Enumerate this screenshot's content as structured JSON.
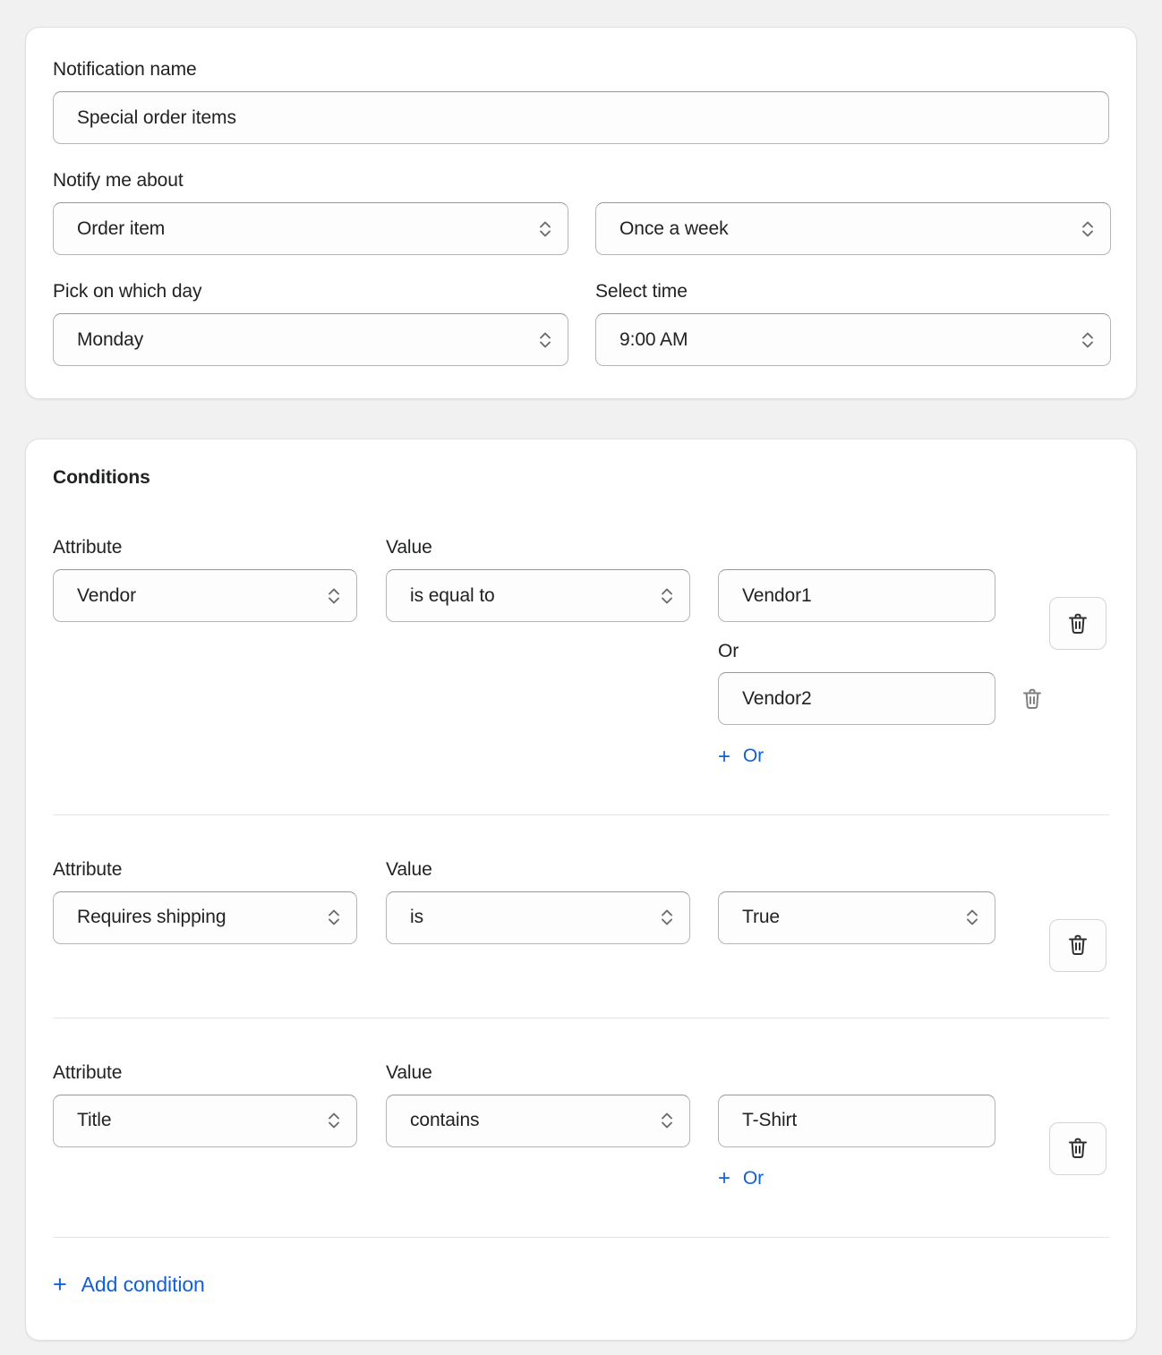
{
  "notification": {
    "name_label": "Notification name",
    "name_value": "Special order items",
    "name_placeholder": "Notification name",
    "notify_about_label": "Notify me about",
    "notify_about_value": "Order item",
    "frequency_value": "Once a week",
    "day_label": "Pick on which day",
    "day_value": "Monday",
    "time_label": "Select time",
    "time_value": "9:00 AM"
  },
  "conditions": {
    "title": "Conditions",
    "attribute_label": "Attribute",
    "value_label": "Value",
    "or_label": "Or",
    "add_or_label": "Or",
    "add_condition_label": "Add condition",
    "plus_glyph": "+",
    "rows": [
      {
        "attribute": "Vendor",
        "operator": "is equal to",
        "value": "Vendor1",
        "value_type": "input",
        "or_values": [
          {
            "value": "Vendor2",
            "value_type": "input"
          }
        ],
        "has_add_or": true
      },
      {
        "attribute": "Requires shipping",
        "operator": "is",
        "value": "True",
        "value_type": "select",
        "or_values": [],
        "has_add_or": false
      },
      {
        "attribute": "Title",
        "operator": "contains",
        "value": "T-Shirt",
        "value_type": "input",
        "or_values": [],
        "has_add_or": true
      }
    ]
  },
  "colors": {
    "accent_link": "#1160d8",
    "text": "#202223",
    "page_bg": "#f1f1f1",
    "card_bg": "#ffffff",
    "border": "#b5b5b5",
    "divider": "#e5e5e5",
    "icon_gray": "#808080"
  },
  "icons": {
    "select_chevrons": "chevron-up-down-icon",
    "delete": "trash-icon",
    "add": "plus-icon"
  }
}
